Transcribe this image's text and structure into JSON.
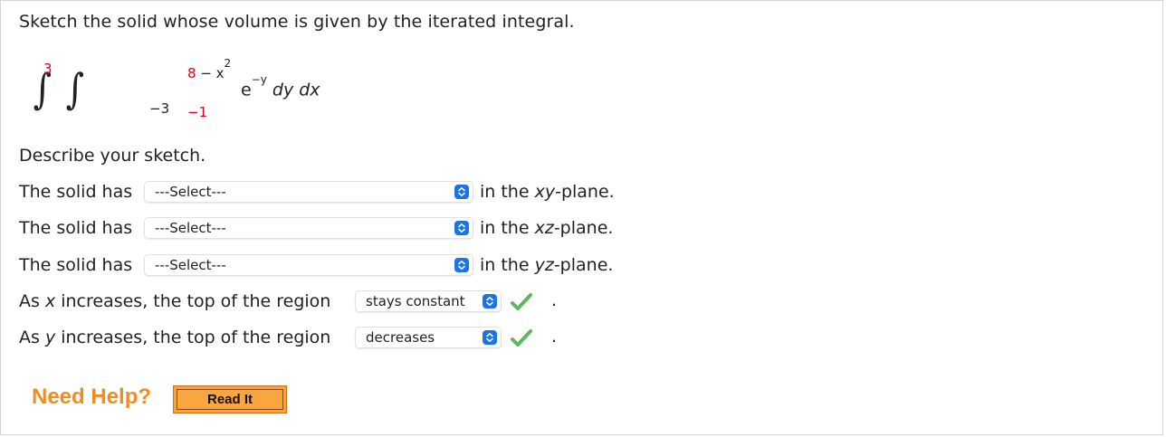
{
  "question": "Sketch the solid whose volume is given by the iterated integral.",
  "integral": {
    "outer_upper": "3",
    "outer_lower": "−3",
    "inner_upper_num": "8",
    "inner_upper_rest": "− x",
    "inner_upper_exp": "2",
    "inner_lower": "−1",
    "integrand_base": "e",
    "integrand_exp": "−y",
    "differentials": "dy dx"
  },
  "describe_label": "Describe your sketch.",
  "rows": [
    {
      "prefix": "The solid has",
      "value": "---Select---",
      "suffix_pre": "in the ",
      "suffix_var": "xy",
      "suffix_post": "-plane."
    },
    {
      "prefix": "The solid has",
      "value": "---Select---",
      "suffix_pre": "in the ",
      "suffix_var": "xz",
      "suffix_post": "-plane."
    },
    {
      "prefix": "The solid has",
      "value": "---Select---",
      "suffix_pre": "in the ",
      "suffix_var": "yz",
      "suffix_post": "-plane."
    }
  ],
  "trend_rows": [
    {
      "pre": "As ",
      "var": "x",
      "post": " increases, the top of the region",
      "value": "stays constant",
      "status": "correct"
    },
    {
      "pre": "As ",
      "var": "y",
      "post": " increases, the top of the region",
      "value": "decreases",
      "status": "correct"
    }
  ],
  "period": ".",
  "help": {
    "label": "Need Help?",
    "button": "Read It"
  },
  "colors": {
    "limits": "#e0001a",
    "help": "#f28c1e",
    "select_arrow": "#1b73e8",
    "check": "#5cb85c"
  },
  "icons": {
    "select_arrow": "chevron-updown-icon",
    "check": "checkmark-icon"
  }
}
